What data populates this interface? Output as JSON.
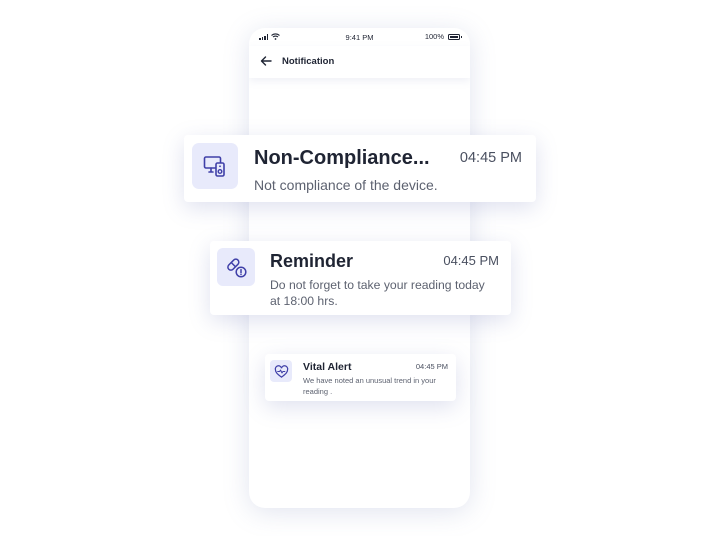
{
  "status_bar": {
    "time": "9:41 PM",
    "battery": "100%"
  },
  "header": {
    "title": "Notification"
  },
  "notifications": [
    {
      "icon": "device-compliance-icon",
      "title": "Non-Compliance...",
      "time": "04:45 PM",
      "message": "Not compliance of the device."
    },
    {
      "icon": "pill-alert-icon",
      "title": "Reminder",
      "time": "04:45 PM",
      "message": "Do not forget to take your reading today at 18:00 hrs."
    },
    {
      "icon": "heart-vital-icon",
      "title": "Vital Alert",
      "time": "04:45 PM",
      "message": "We have noted an unusual trend in your reading ."
    }
  ],
  "colors": {
    "accent": "#3f3fa8",
    "icon_bg": "#e8eafb",
    "text": "#1f2433"
  }
}
